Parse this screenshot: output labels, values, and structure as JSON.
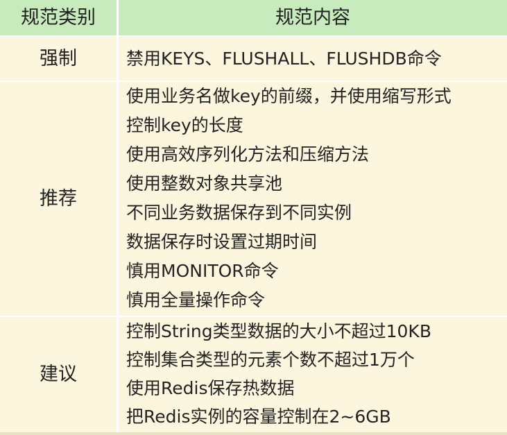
{
  "header": {
    "category": "规范类别",
    "content": "规范内容"
  },
  "groups": [
    {
      "category": "强制",
      "items": [
        "禁用KEYS、FLUSHALL、FLUSHDB命令"
      ]
    },
    {
      "category": "推荐",
      "items": [
        "使用业务名做key的前缀，并使用缩写形式",
        "控制key的长度",
        "使用高效序列化方法和压缩方法",
        "使用整数对象共享池",
        "不同业务数据保存到不同实例",
        "数据保存时设置过期时间",
        "慎用MONITOR命令",
        "慎用全量操作命令"
      ]
    },
    {
      "category": "建议",
      "items": [
        "控制String类型数据的大小不超过10KB",
        "控制集合类型的元素个数不超过1万个",
        "使用Redis保存热数据",
        "把Redis实例的容量控制在2~6GB"
      ]
    }
  ]
}
